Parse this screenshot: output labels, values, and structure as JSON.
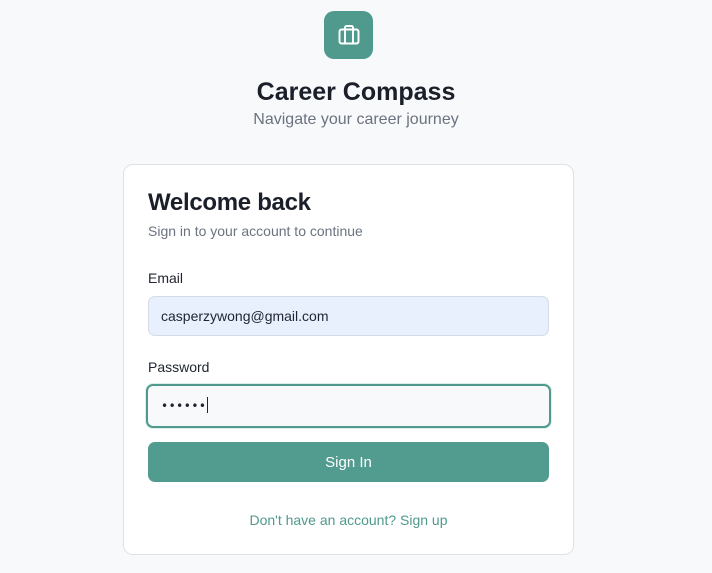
{
  "app": {
    "logo_icon": "briefcase-icon",
    "title": "Career Compass",
    "subtitle": "Navigate your career journey",
    "accent_color": "#4f9a8d"
  },
  "login_card": {
    "title": "Welcome back",
    "subtitle": "Sign in to your account to continue",
    "email": {
      "label": "Email",
      "value": "casperzywong@gmail.com"
    },
    "password": {
      "label": "Password",
      "masked_value": "••••••"
    },
    "signin_label": "Sign In",
    "signup_text": "Don't have an account? Sign up"
  }
}
